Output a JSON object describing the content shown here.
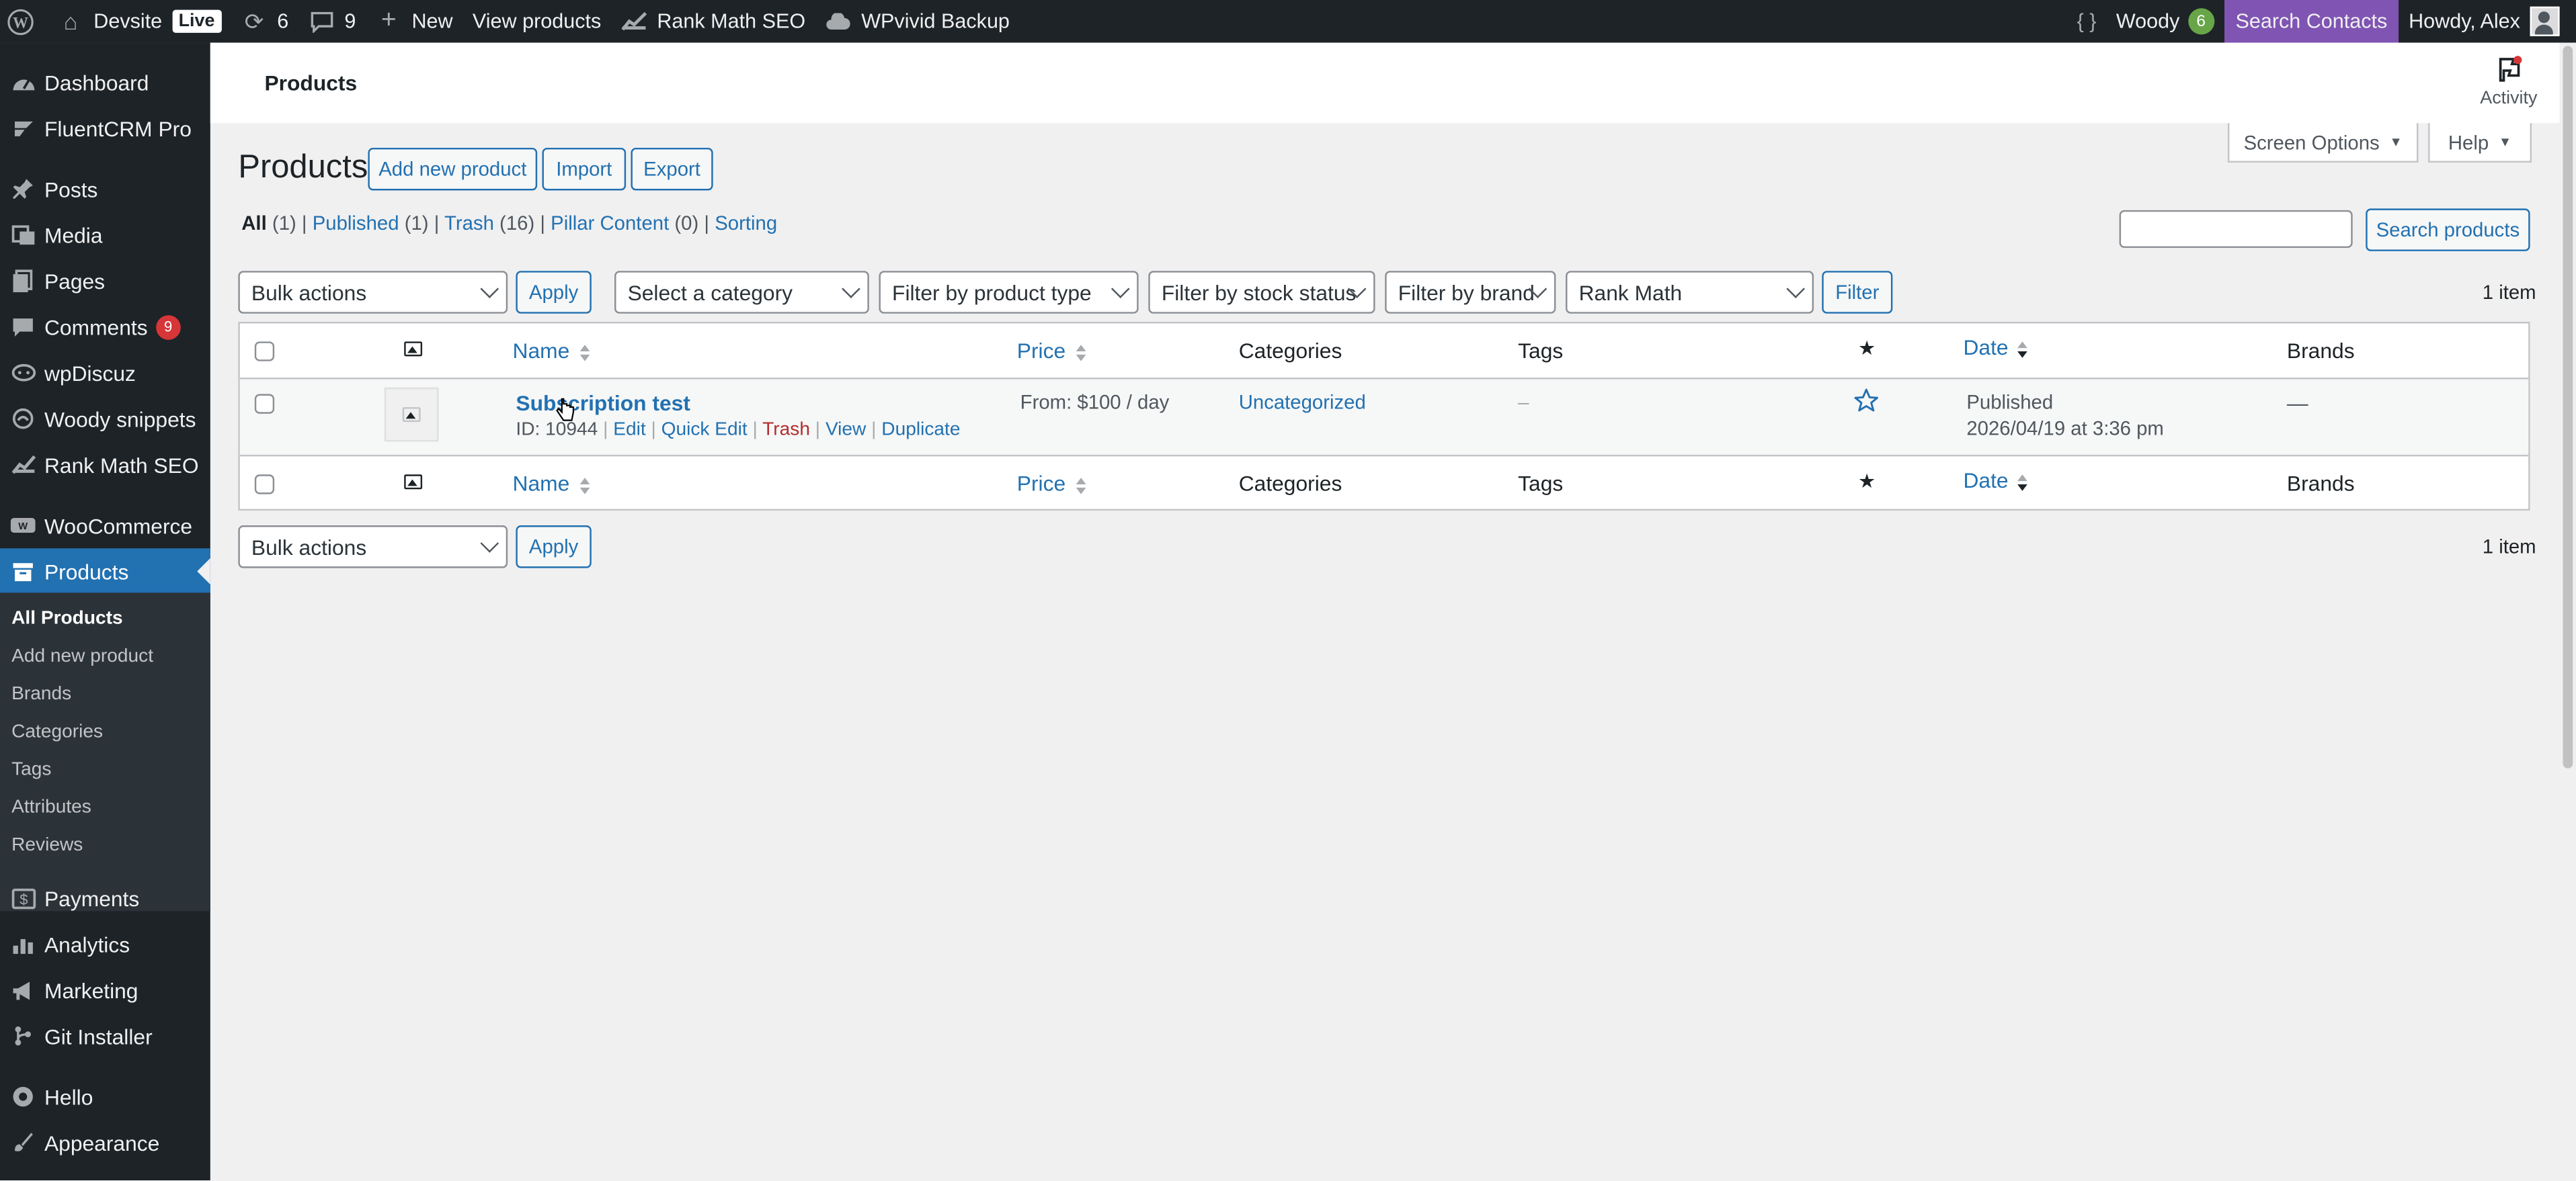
{
  "adminbar": {
    "site_name": "Devsite",
    "live_badge": "Live",
    "updates_count": "6",
    "comments_count": "9",
    "new_label": "New",
    "view_products": "View products",
    "rank_math": "Rank Math SEO",
    "wpvivid": "WPvivid Backup",
    "braces": "{ }",
    "woody": "Woody",
    "woody_count": "6",
    "search_contacts": "Search Contacts",
    "howdy": "Howdy, Alex"
  },
  "sidebar": {
    "items": [
      {
        "label": "Dashboard",
        "icon": "dashboard-icon"
      },
      {
        "label": "FluentCRM Pro",
        "icon": "fluentcrm-icon"
      },
      {
        "label": "Posts",
        "icon": "pin-icon"
      },
      {
        "label": "Media",
        "icon": "media-icon"
      },
      {
        "label": "Pages",
        "icon": "pages-icon"
      },
      {
        "label": "Comments",
        "icon": "comments-icon",
        "badge": "9"
      },
      {
        "label": "wpDiscuz",
        "icon": "discuz-icon"
      },
      {
        "label": "Woody snippets",
        "icon": "snippets-icon"
      },
      {
        "label": "Rank Math SEO",
        "icon": "rankmath-icon"
      },
      {
        "label": "WooCommerce",
        "icon": "woo-icon"
      },
      {
        "label": "Products",
        "icon": "archive-icon"
      },
      {
        "label": "Payments",
        "icon": "payments-icon"
      },
      {
        "label": "Analytics",
        "icon": "analytics-icon"
      },
      {
        "label": "Marketing",
        "icon": "megaphone-icon"
      },
      {
        "label": "Git Installer",
        "icon": "git-icon"
      },
      {
        "label": "Hello",
        "icon": "hello-icon"
      },
      {
        "label": "Appearance",
        "icon": "brush-icon"
      }
    ],
    "submenu": [
      "All Products",
      "Add new product",
      "Brands",
      "Categories",
      "Tags",
      "Attributes",
      "Reviews"
    ]
  },
  "header": {
    "title": "Products",
    "activity": "Activity",
    "screen_options": "Screen Options",
    "help": "Help"
  },
  "main": {
    "heading": "Products",
    "add_new": "Add new product",
    "import": "Import",
    "export": "Export",
    "views": {
      "all": "All",
      "all_count": "(1)",
      "published": "Published",
      "published_count": "(1)",
      "trash": "Trash",
      "trash_count": "(16)",
      "pillar": "Pillar Content",
      "pillar_count": "(0)",
      "sorting": "Sorting"
    },
    "search_placeholder": "",
    "search_button": "Search products",
    "bulk_actions": "Bulk actions",
    "apply": "Apply",
    "category_filter": "Select a category",
    "type_filter": "Filter by product type",
    "stock_filter": "Filter by stock status",
    "brand_filter": "Filter by brand",
    "rank_math_filter": "Rank Math",
    "filter_button": "Filter",
    "item_count": "1 item"
  },
  "table": {
    "columns": {
      "name": "Name",
      "price": "Price",
      "categories": "Categories",
      "tags": "Tags",
      "date": "Date",
      "brands": "Brands"
    },
    "rows": [
      {
        "name": "Subscription test",
        "id_label": "ID: 10944",
        "actions": {
          "edit": "Edit",
          "quick_edit": "Quick Edit",
          "trash": "Trash",
          "view": "View",
          "duplicate": "Duplicate"
        },
        "price": "From: $100 / day",
        "categories": "Uncategorized",
        "tags": "–",
        "date_status": "Published",
        "date_value": "2026/04/19 at 3:36 pm",
        "brands": "—"
      }
    ]
  },
  "colors": {
    "accent": "#2271b1",
    "admin_bg": "#1d2327",
    "purple": "#7f54b3"
  }
}
